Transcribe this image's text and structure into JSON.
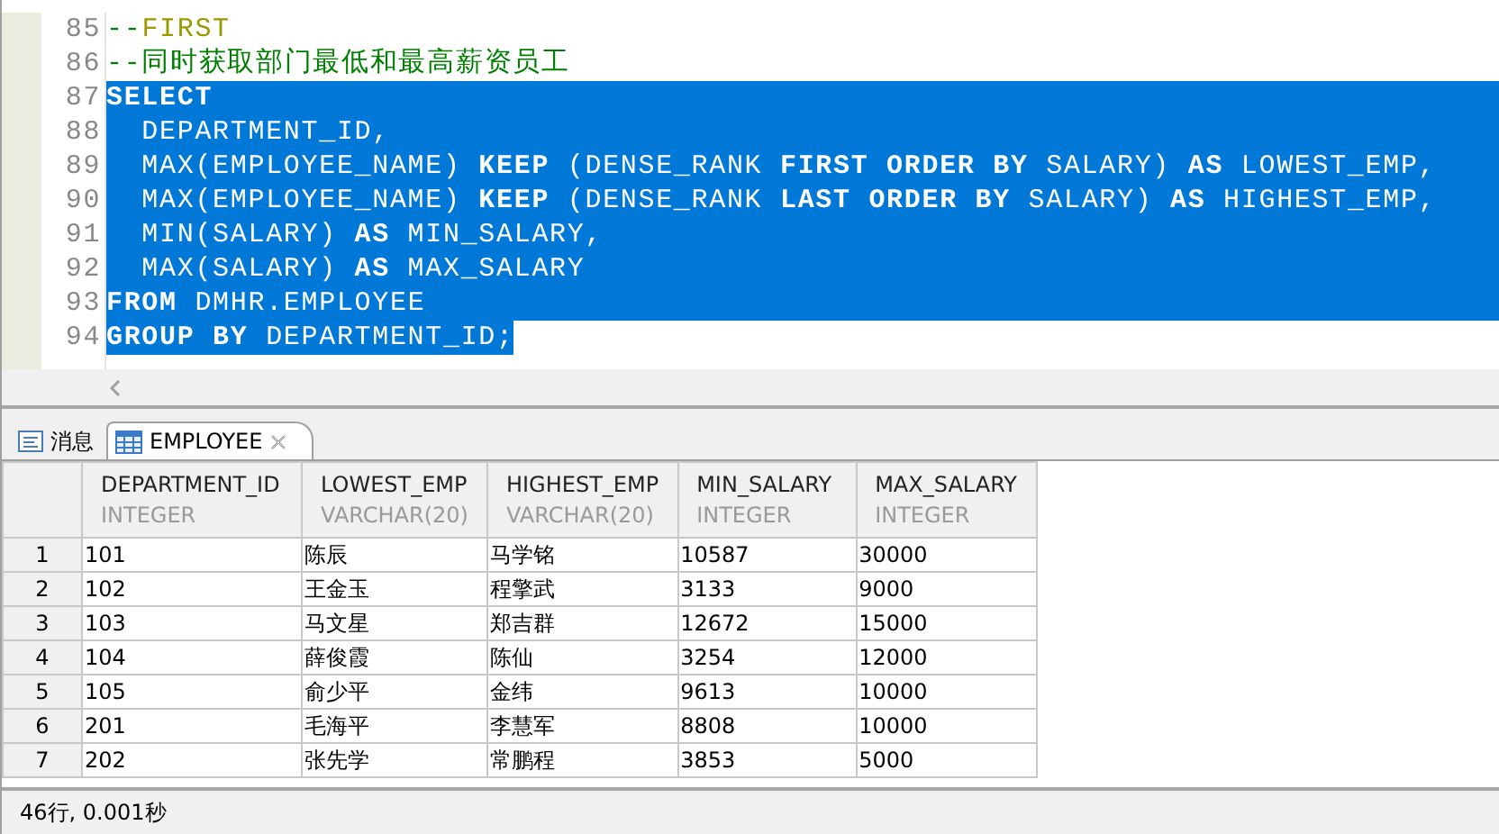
{
  "editor": {
    "lines": [
      {
        "number": "85",
        "selected": false,
        "tokens": [
          {
            "kind": "comment",
            "text": "--"
          },
          {
            "kind": "comment_keyword",
            "text": "FIRST"
          }
        ]
      },
      {
        "number": "86",
        "selected": false,
        "tokens": [
          {
            "kind": "comment",
            "text": "--同时获取部门最低和最高薪资员工"
          }
        ]
      },
      {
        "number": "87",
        "selected": true,
        "tokens": [
          {
            "kind": "keyword",
            "text": "SELECT"
          }
        ]
      },
      {
        "number": "88",
        "selected": true,
        "tokens": [
          {
            "kind": "plain",
            "text": "  DEPARTMENT_ID,"
          }
        ]
      },
      {
        "number": "89",
        "selected": true,
        "tokens": [
          {
            "kind": "plain",
            "text": "  MAX(EMPLOYEE_NAME) "
          },
          {
            "kind": "keyword",
            "text": "KEEP"
          },
          {
            "kind": "plain",
            "text": " (DENSE_RANK "
          },
          {
            "kind": "keyword",
            "text": "FIRST ORDER BY"
          },
          {
            "kind": "plain",
            "text": " SALARY) "
          },
          {
            "kind": "keyword",
            "text": "AS"
          },
          {
            "kind": "plain",
            "text": " LOWEST_EMP,"
          }
        ]
      },
      {
        "number": "90",
        "selected": true,
        "tokens": [
          {
            "kind": "plain",
            "text": "  MAX(EMPLOYEE_NAME) "
          },
          {
            "kind": "keyword",
            "text": "KEEP"
          },
          {
            "kind": "plain",
            "text": " (DENSE_RANK "
          },
          {
            "kind": "keyword",
            "text": "LAST ORDER BY"
          },
          {
            "kind": "plain",
            "text": " SALARY) "
          },
          {
            "kind": "keyword",
            "text": "AS"
          },
          {
            "kind": "plain",
            "text": " HIGHEST_EMP,"
          }
        ]
      },
      {
        "number": "91",
        "selected": true,
        "tokens": [
          {
            "kind": "plain",
            "text": "  MIN(SALARY) "
          },
          {
            "kind": "keyword",
            "text": "AS"
          },
          {
            "kind": "plain",
            "text": " MIN_SALARY,"
          }
        ]
      },
      {
        "number": "92",
        "selected": true,
        "tokens": [
          {
            "kind": "plain",
            "text": "  MAX(SALARY) "
          },
          {
            "kind": "keyword",
            "text": "AS"
          },
          {
            "kind": "plain",
            "text": " MAX_SALARY"
          }
        ]
      },
      {
        "number": "93",
        "selected": true,
        "tokens": [
          {
            "kind": "keyword",
            "text": "FROM"
          },
          {
            "kind": "plain",
            "text": " DMHR.EMPLOYEE"
          }
        ]
      },
      {
        "number": "94",
        "selected": true,
        "tokens": [
          {
            "kind": "keyword",
            "text": "GROUP BY"
          },
          {
            "kind": "plain",
            "text": " DEPARTMENT_ID;"
          }
        ]
      }
    ]
  },
  "tabs": [
    {
      "label": "消息",
      "kind": "message",
      "selected": false,
      "closable": false
    },
    {
      "label": "EMPLOYEE",
      "kind": "table",
      "selected": true,
      "closable": true
    }
  ],
  "table": {
    "columns": [
      {
        "name": "DEPARTMENT_ID",
        "type": "INTEGER"
      },
      {
        "name": "LOWEST_EMP",
        "type": "VARCHAR(20)"
      },
      {
        "name": "HIGHEST_EMP",
        "type": "VARCHAR(20)"
      },
      {
        "name": "MIN_SALARY",
        "type": "INTEGER"
      },
      {
        "name": "MAX_SALARY",
        "type": "INTEGER"
      }
    ],
    "rows": [
      {
        "number": "1",
        "cells": [
          "101",
          "陈辰",
          "马学铭",
          "10587",
          "30000"
        ]
      },
      {
        "number": "2",
        "cells": [
          "102",
          "王金玉",
          "程擎武",
          "3133",
          "9000"
        ]
      },
      {
        "number": "3",
        "cells": [
          "103",
          "马文星",
          "郑吉群",
          "12672",
          "15000"
        ]
      },
      {
        "number": "4",
        "cells": [
          "104",
          "薛俊霞",
          "陈仙",
          "3254",
          "12000"
        ]
      },
      {
        "number": "5",
        "cells": [
          "105",
          "俞少平",
          "金纬",
          "9613",
          "10000"
        ]
      },
      {
        "number": "6",
        "cells": [
          "201",
          "毛海平",
          "李慧军",
          "8808",
          "10000"
        ]
      },
      {
        "number": "7",
        "cells": [
          "202",
          "张先学",
          "常鹏程",
          "3853",
          "5000"
        ]
      }
    ]
  },
  "status_bar": {
    "text": "46行, 0.001秒"
  }
}
